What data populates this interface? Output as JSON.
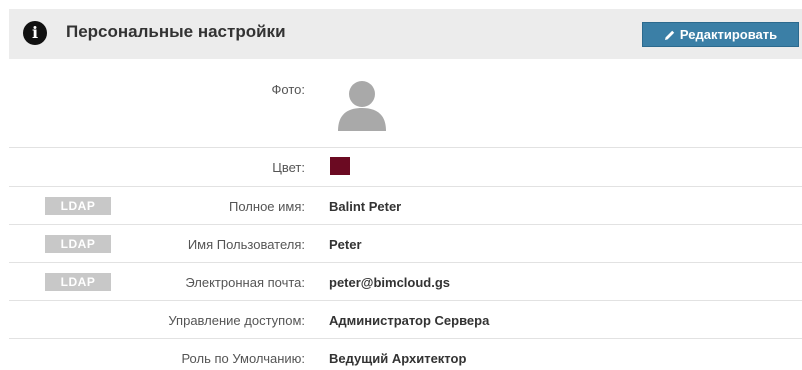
{
  "header": {
    "title": "Персональные настройки",
    "edit_label": "Редактировать"
  },
  "colors": {
    "header_bg": "#ececec",
    "edit_button": "#3b7fa6",
    "user_color": "#6b0a22",
    "ldap_badge": "#c8c8c8"
  },
  "fields": {
    "photo_label": "Фото:",
    "color_label": "Цвет:",
    "fullname": {
      "badge": "LDAP",
      "label": "Полное имя:",
      "value": "Balint Peter"
    },
    "username": {
      "badge": "LDAP",
      "label": "Имя Пользователя:",
      "value": "Peter"
    },
    "email": {
      "badge": "LDAP",
      "label": "Электронная почта:",
      "value": "peter@bimcloud.gs"
    },
    "access": {
      "label": "Управление доступом:",
      "value": "Администратор Сервера"
    },
    "role": {
      "label": "Роль по Умолчанию:",
      "value": "Ведущий Архитектор"
    }
  }
}
